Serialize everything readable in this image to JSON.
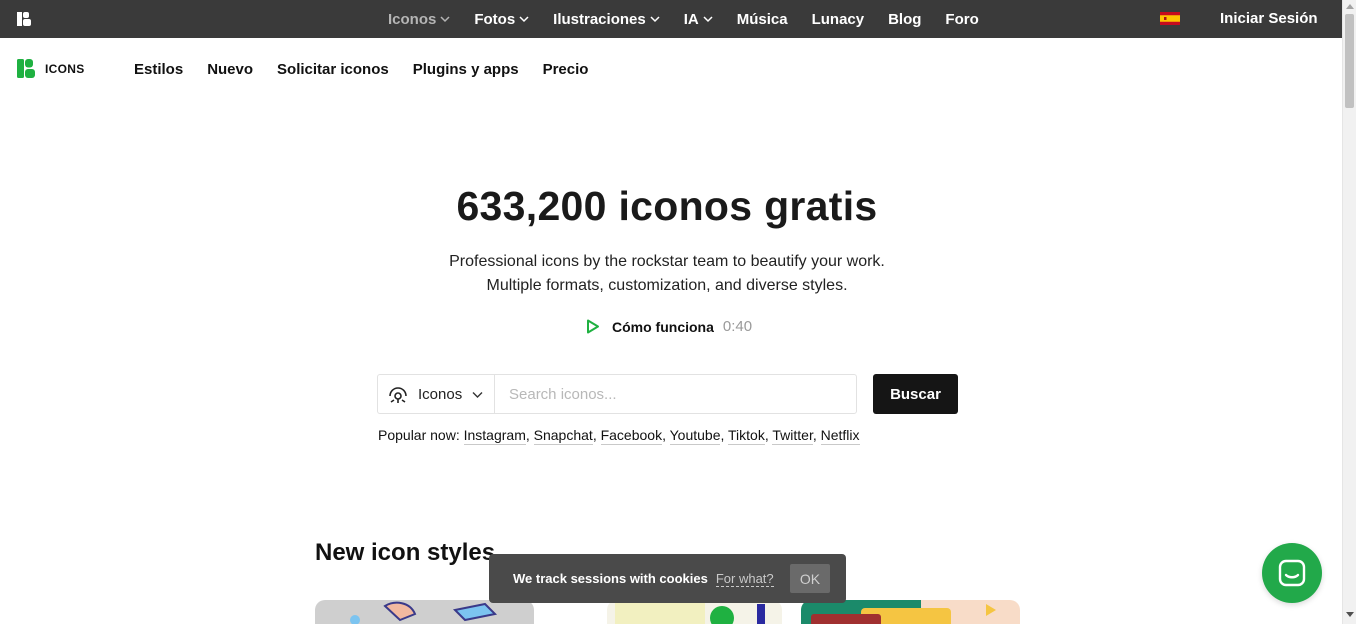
{
  "topbar": {
    "logo_icon": "icons8-logo-icon",
    "items": [
      {
        "label": "Iconos",
        "dropdown": true,
        "active": true
      },
      {
        "label": "Fotos",
        "dropdown": true
      },
      {
        "label": "Ilustraciones",
        "dropdown": true
      },
      {
        "label": "IA",
        "dropdown": true
      },
      {
        "label": "Música",
        "dropdown": false
      },
      {
        "label": "Lunacy",
        "dropdown": false
      },
      {
        "label": "Blog",
        "dropdown": false
      },
      {
        "label": "Foro",
        "dropdown": false
      }
    ],
    "language_flag": "spain-flag-icon",
    "signin_label": "Iniciar Sesión"
  },
  "subnav": {
    "brand_label": "ICONS",
    "links": [
      "Estilos",
      "Nuevo",
      "Solicitar iconos",
      "Plugins y apps",
      "Precio"
    ]
  },
  "hero": {
    "title": "633,200 iconos gratis",
    "subtitle_line1": "Professional icons by the rockstar team to beautify your work.",
    "subtitle_line2": "Multiple formats, customization, and diverse styles.",
    "howto_label": "Cómo funciona",
    "howto_duration": "0:40"
  },
  "search": {
    "type_value": "Iconos",
    "placeholder": "Search iconos...",
    "value": "",
    "button_label": "Buscar",
    "popular_prefix": "Popular now:",
    "popular_items": [
      "Instagram",
      "Snapchat",
      "Facebook",
      "Youtube",
      "Tiktok",
      "Twitter",
      "Netflix"
    ]
  },
  "new_styles": {
    "title": "New icon styles"
  },
  "cookie": {
    "message": "We track sessions with cookies",
    "link_label": "For what?",
    "ok_label": "OK"
  },
  "colors": {
    "topbar_bg": "#3a3a3a",
    "brand_green": "#1fb141",
    "button_dark": "#151515",
    "chat_green": "#22a94a"
  }
}
